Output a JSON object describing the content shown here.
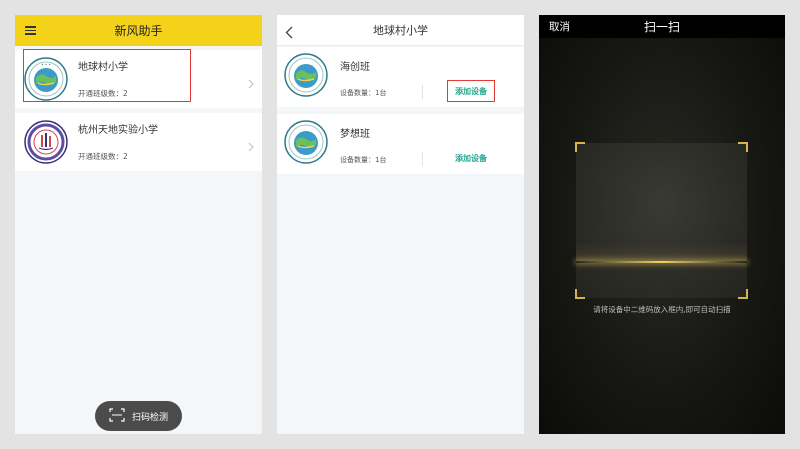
{
  "screen1": {
    "title": "新风助手",
    "schools": [
      {
        "name": "地球村小学",
        "classes": "开通班级数：2"
      },
      {
        "name": "杭州天地实验小学",
        "classes": "开通班级数：2"
      }
    ],
    "scan_button": "扫码检测"
  },
  "screen2": {
    "title": "地球村小学",
    "classes": [
      {
        "name": "海创班",
        "device_count": "设备数量：1台",
        "add_label": "添加设备"
      },
      {
        "name": "梦想班",
        "device_count": "设备数量：1台",
        "add_label": "添加设备"
      }
    ]
  },
  "screen3": {
    "cancel": "取消",
    "title": "扫一扫",
    "hint": "请将设备中二维码放入框内,即可自动扫描"
  },
  "colors": {
    "header_yellow": "#f5d21a",
    "accent_green": "#23a88f",
    "highlight_red": "#e53935",
    "scan_gold": "#d8b24a"
  }
}
